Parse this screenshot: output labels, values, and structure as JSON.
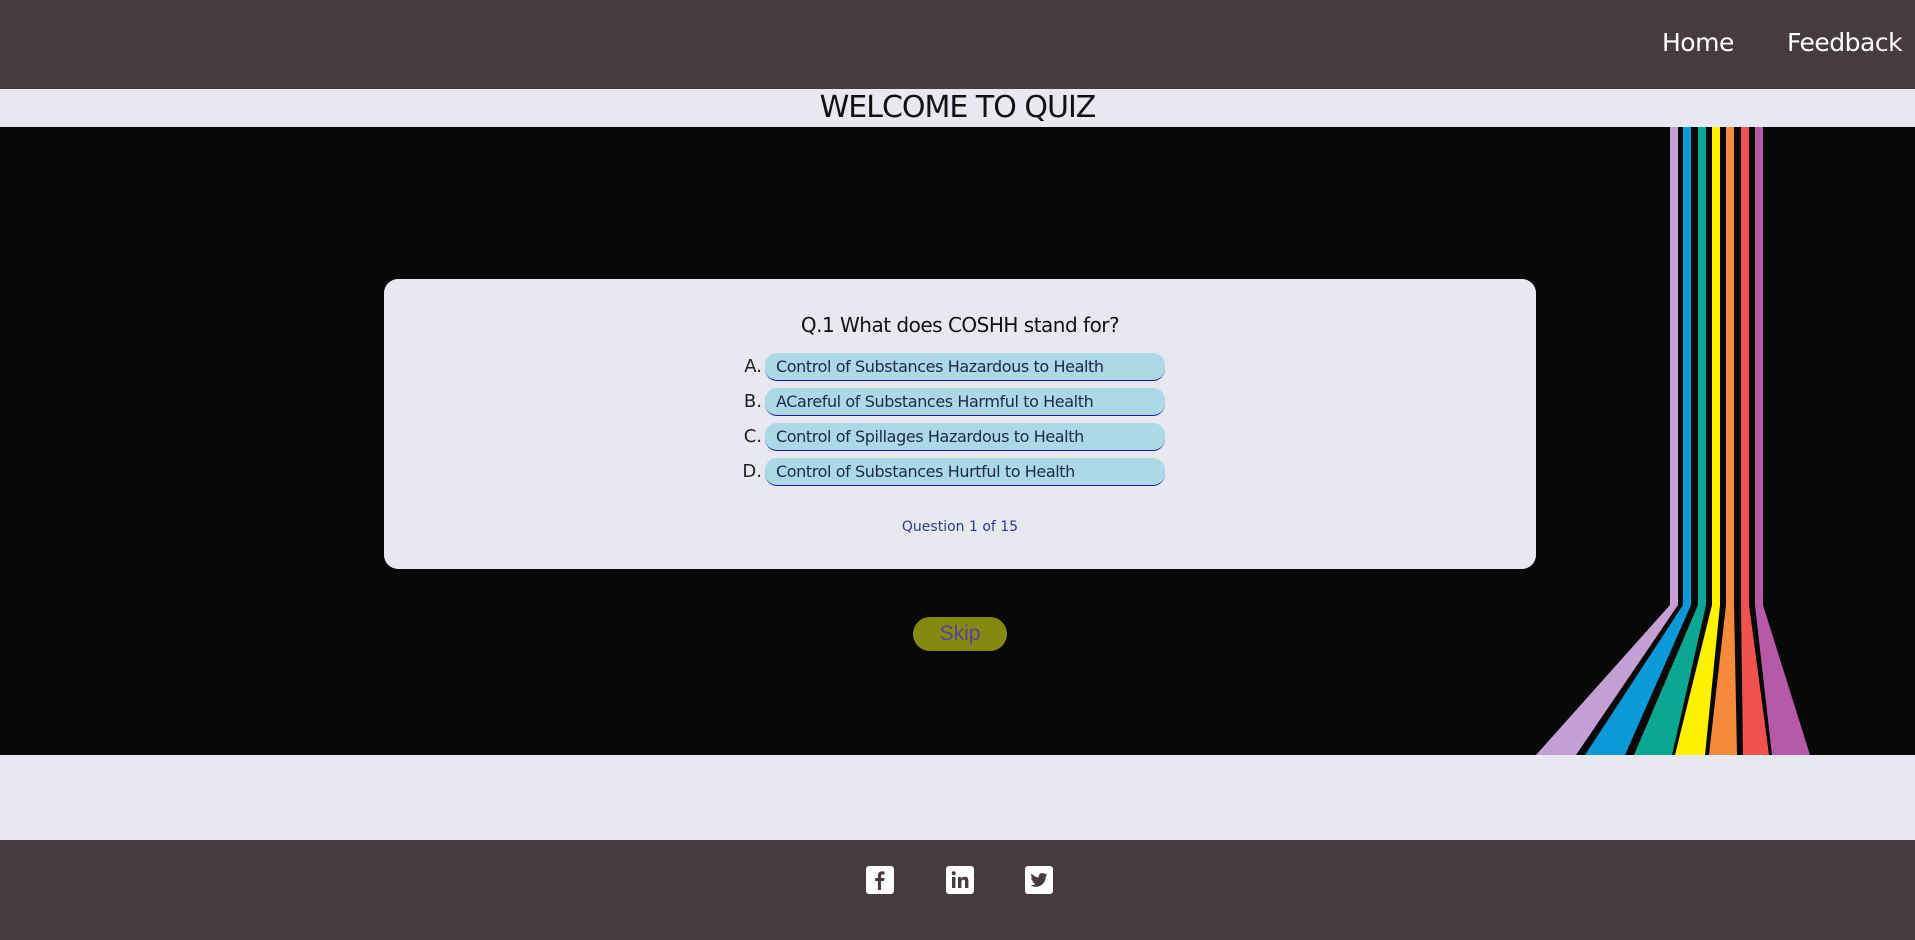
{
  "nav": {
    "home": "Home",
    "feedback": "Feedback"
  },
  "page": {
    "title": "WELCOME TO QUIZ"
  },
  "quiz": {
    "question": "Q.1 What does COSHH stand for?",
    "answers": [
      {
        "letter": "A.",
        "text": "Control of Substances Hazardous to Health"
      },
      {
        "letter": "B.",
        "text": "ACareful of Substances Harmful to Health"
      },
      {
        "letter": "C.",
        "text": "Control of Spillages Hazardous to Health"
      },
      {
        "letter": "D.",
        "text": "Control of Substances Hurtful to Health"
      }
    ],
    "progress": "Question 1 of 15",
    "skip_label": "Skip"
  },
  "footer": {
    "social_icons": [
      "facebook-icon",
      "linkedin-icon",
      "twitter-icon"
    ]
  },
  "colors": {
    "header_bg": "#463c3e",
    "page_bg": "#e8e8f0",
    "hero_bg": "#080808",
    "answer_bg": "#add8e6",
    "skip_bg": "#848a10",
    "rainbow": [
      "#c49fd4",
      "#0a9ad8",
      "#0aa892",
      "#fff200",
      "#f58a3c",
      "#f0524f",
      "#b65aa8"
    ]
  }
}
